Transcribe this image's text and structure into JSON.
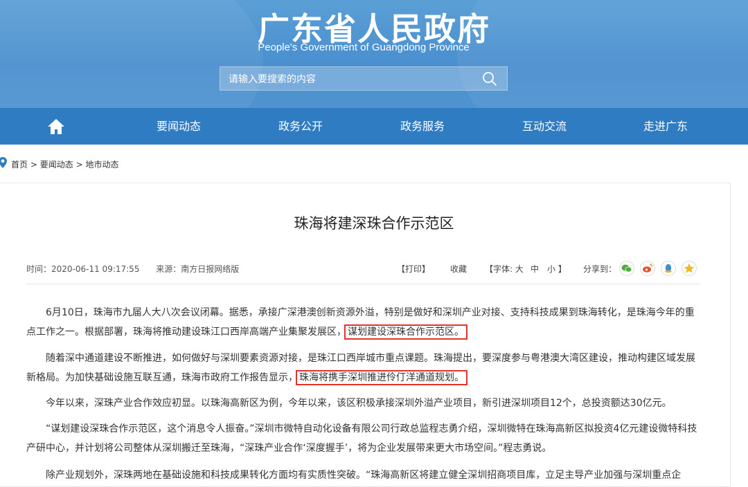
{
  "header": {
    "title": "广东省人民政府",
    "subtitle": "People's Government of Guangdong Province",
    "search_placeholder": "请输入要搜索的内容"
  },
  "nav": {
    "home_icon": "home-icon",
    "items": [
      "要闻动态",
      "政务公开",
      "政务服务",
      "互动交流",
      "走进广东"
    ]
  },
  "breadcrumb": {
    "icon": "location-pin-icon",
    "items": [
      "首页",
      "要闻动态",
      "地市动态"
    ],
    "separator": ">"
  },
  "article": {
    "title": "珠海将建深珠合作示范区",
    "time": "时间：2020-06-11 09:17:55",
    "source": "来源：南方日报网络版",
    "print": "【打印】",
    "favorite": "收藏",
    "font_label": "【字体: 大",
    "font_mid": "中",
    "font_small": "小 】",
    "share_label": "分享到：",
    "share_icons": [
      "wechat-icon",
      "weibo-icon",
      "qq-icon",
      "qzone-icon"
    ],
    "p1_a": "6月10日，珠海市九届人大八次会议闭幕。据悉，承接广深港澳创新资源外溢，特别是做好和深圳产业对接、支持科技成果到珠海转化，是珠海今年的重点工作之一。根据部署，珠海将推动建设珠江口西岸高端产业集聚发展区，",
    "p1_hl": "谋划建设深珠合作示范区。",
    "p2_a": "随着深中通道建设不断推进，如何做好与深圳要素资源对接，是珠江口西岸城市重点课题。珠海提出，要深度参与粤港澳大湾区建设，推动构建区域发展新格局。为加快基础设施互联互通，珠海市政府工作报告显示，",
    "p2_hl": "珠海将携手深圳推进伶仃洋通道规划。",
    "p3": "今年以来，深珠产业合作效应初显。以珠海高新区为例，今年以来，该区积极承接深圳外溢产业项目，新引进深圳项目12个，总投资额达30亿元。",
    "p4": "“谋划建设深珠合作示范区，这个消息令人振奋。”深圳市微特自动化设备有限公司行政总监程志勇介绍，深圳微特在珠海高新区拟投资4亿元建设微特科技产研中心，并计划将公司整体从深圳搬迁至珠海，“深珠产业合作‘深度握手’，将为企业发展带来更大市场空间。”程志勇说。",
    "p5": "除产业规划外，深珠两地在基础设施和科技成果转化方面均有实质性突破。“珠海高新区将建立健全深圳招商项目库，立足主导产业加强与深圳重点企"
  },
  "colors": {
    "header_bg": "#4a8fcf",
    "nav_bg": "#2f7cc3",
    "highlight_box": "#e4322b"
  }
}
